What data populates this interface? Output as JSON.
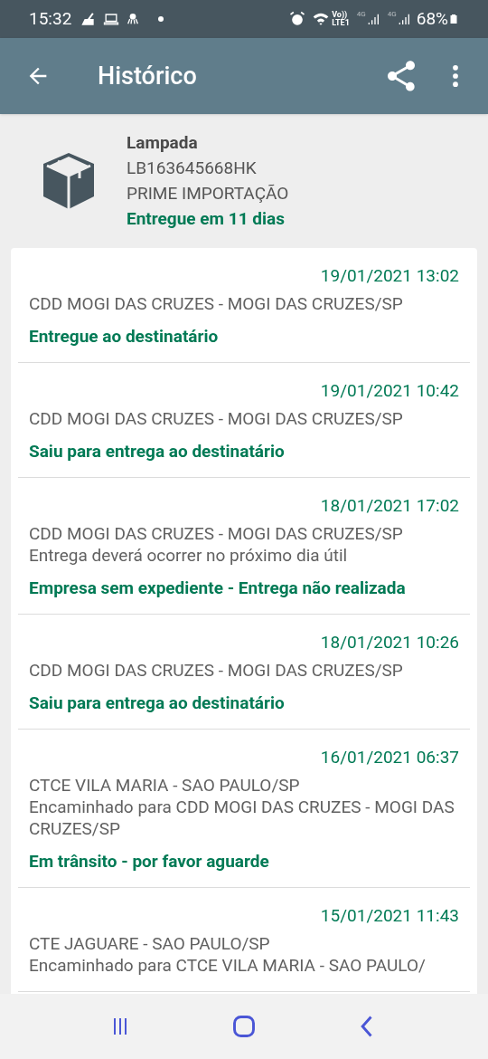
{
  "status_bar": {
    "time": "15:32",
    "volte": "Vo))",
    "lte": "LTE1",
    "network_1": "4G",
    "network_2": "4G",
    "battery": "68%"
  },
  "app_bar": {
    "title": "Histórico"
  },
  "package": {
    "name": "Lampada",
    "code": "LB163645668HK",
    "sender": "PRIME IMPORTAÇÃO",
    "summary": "Entregue em 11 dias"
  },
  "events": [
    {
      "datetime": "19/01/2021 13:02",
      "lines": [
        "CDD MOGI DAS CRUZES - MOGI DAS CRUZES/SP"
      ],
      "status": "Entregue ao destinatário"
    },
    {
      "datetime": "19/01/2021 10:42",
      "lines": [
        "CDD MOGI DAS CRUZES - MOGI DAS CRUZES/SP"
      ],
      "status": "Saiu para entrega ao destinatário"
    },
    {
      "datetime": "18/01/2021 17:02",
      "lines": [
        "CDD MOGI DAS CRUZES - MOGI DAS CRUZES/SP",
        "Entrega deverá ocorrer no próximo dia útil"
      ],
      "status": "Empresa sem expediente - Entrega não realizada"
    },
    {
      "datetime": "18/01/2021 10:26",
      "lines": [
        "CDD MOGI DAS CRUZES - MOGI DAS CRUZES/SP"
      ],
      "status": "Saiu para entrega ao destinatário"
    },
    {
      "datetime": "16/01/2021 06:37",
      "lines": [
        "CTCE VILA MARIA - SAO PAULO/SP",
        "Encaminhado para CDD MOGI DAS CRUZES - MOGI DAS CRUZES/SP"
      ],
      "status": "Em trânsito - por favor aguarde"
    },
    {
      "datetime": "15/01/2021 11:43",
      "lines": [
        "CTE JAGUARE - SAO PAULO/SP",
        "Encaminhado para CTCE VILA MARIA - SAO PAULO/"
      ]
    }
  ]
}
